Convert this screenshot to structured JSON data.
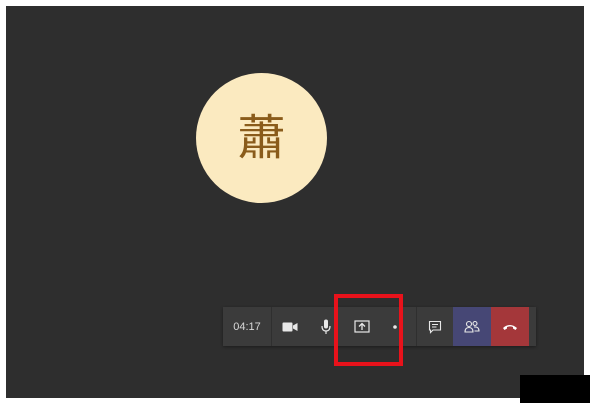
{
  "call": {
    "avatar_initial": "蕭",
    "avatar_bg_color": "#fbeac0",
    "avatar_text_color": "#8a5c1b",
    "background_color": "#2e2e2e"
  },
  "toolbar": {
    "duration": "04:17",
    "buttons": [
      {
        "name": "camera",
        "icon": "video-camera-icon"
      },
      {
        "name": "microphone",
        "icon": "microphone-icon"
      },
      {
        "name": "share",
        "icon": "share-screen-icon",
        "highlighted": true
      },
      {
        "name": "more",
        "icon": "more-options-icon"
      },
      {
        "name": "chat",
        "icon": "chat-icon"
      },
      {
        "name": "participants",
        "icon": "participants-icon",
        "color": "#464775"
      },
      {
        "name": "hang-up",
        "icon": "hang-up-icon",
        "color": "#a4373a"
      }
    ],
    "highlight_color": "#e8121b"
  }
}
